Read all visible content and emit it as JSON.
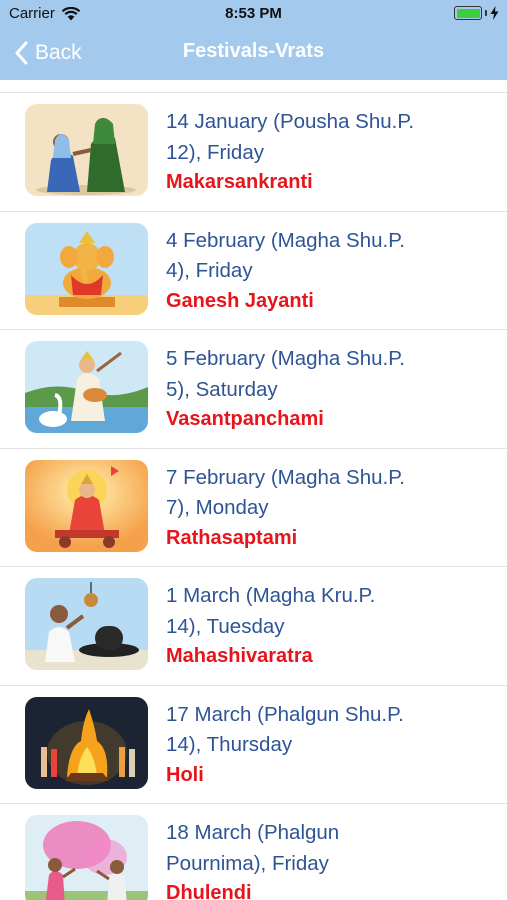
{
  "status_bar": {
    "carrier": "Carrier",
    "time": "8:53 PM",
    "icons": [
      "wifi-icon",
      "battery-icon",
      "charging-bolt-icon"
    ],
    "battery_color": "#3ecf3e"
  },
  "nav": {
    "back_label": "Back",
    "title": "Festivals-Vrats",
    "background": "#a3c9ec"
  },
  "colors": {
    "date_text": "#2e5496",
    "festival_name": "#e8141c"
  },
  "festivals": [
    {
      "date_line1": "14 January (Pousha Shu.P.",
      "date_line2": "12), Friday",
      "name": "Makarsankranti",
      "image": "two-women-greeting"
    },
    {
      "date_line1": "4 February (Magha Shu.P.",
      "date_line2": "4), Friday",
      "name": "Ganesh Jayanti",
      "image": "ganesha-idol"
    },
    {
      "date_line1": "5 February (Magha Shu.P.",
      "date_line2": "5), Saturday",
      "name": "Vasantpanchami",
      "image": "saraswati-with-swan"
    },
    {
      "date_line1": "7 February (Magha Shu.P.",
      "date_line2": "7), Monday",
      "name": "Rathasaptami",
      "image": "surya-on-chariot"
    },
    {
      "date_line1": "1 March (Magha Kru.P.",
      "date_line2": "14), Tuesday",
      "name": "Mahashivaratra",
      "image": "man-worshipping-shivling"
    },
    {
      "date_line1": "17  March (Phalgun Shu.P.",
      "date_line2": "14), Thursday",
      "name": "Holi",
      "image": "holika-bonfire"
    },
    {
      "date_line1": "18 March (Phalgun",
      "date_line2": "Pournima), Friday",
      "name": "Dhulendi",
      "image": "people-playing-colors"
    }
  ]
}
